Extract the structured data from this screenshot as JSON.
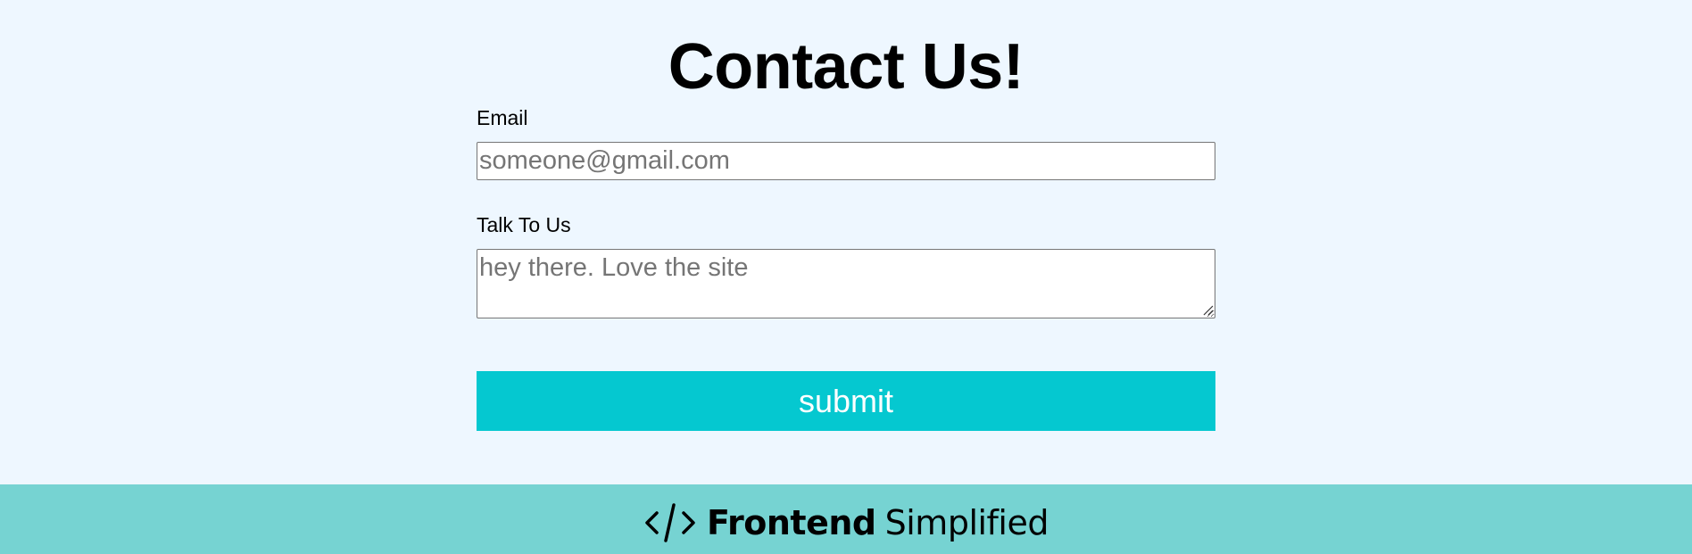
{
  "contact": {
    "title": "Contact Us!",
    "email_label": "Email",
    "email_placeholder": "someone@gmail.com",
    "message_label": "Talk To Us",
    "message_placeholder": "hey there. Love the site",
    "submit_label": "submit"
  },
  "footer": {
    "logo_icon": "code-brackets-icon",
    "brand_bold": "Frontend",
    "brand_light": "Simplified"
  },
  "colors": {
    "page_background": "#eef7ff",
    "submit_background": "#05c8d0",
    "footer_background": "#76d3d2",
    "text": "#000000",
    "placeholder": "#757575"
  }
}
